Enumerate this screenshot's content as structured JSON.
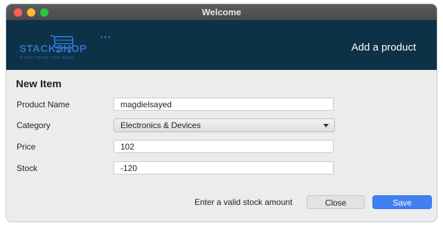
{
  "window": {
    "title": "Welcome"
  },
  "banner": {
    "logo_text": "STACKSHOP",
    "logo_tagline": "EVERYTHING YOU NEED",
    "heading": "Add a product"
  },
  "form": {
    "title": "New Item",
    "fields": {
      "product_name": {
        "label": "Product Name",
        "value": "magdielsayed"
      },
      "category": {
        "label": "Category",
        "value": "Electronics & Devices"
      },
      "price": {
        "label": "Price",
        "value": "102"
      },
      "stock": {
        "label": "Stock",
        "value": "-120"
      }
    },
    "error_message": "Enter a valid stock amount",
    "buttons": {
      "close": "Close",
      "save": "Save"
    }
  },
  "colors": {
    "banner_bg": "#0d3146",
    "logo_blue": "#2f73c7",
    "save_button": "#3f7ff0"
  },
  "icons": {
    "window_controls": [
      "close-dot",
      "minimize-dot",
      "zoom-dot"
    ],
    "logo": "shopping-cart-icon",
    "select": "chevron-down-icon"
  }
}
